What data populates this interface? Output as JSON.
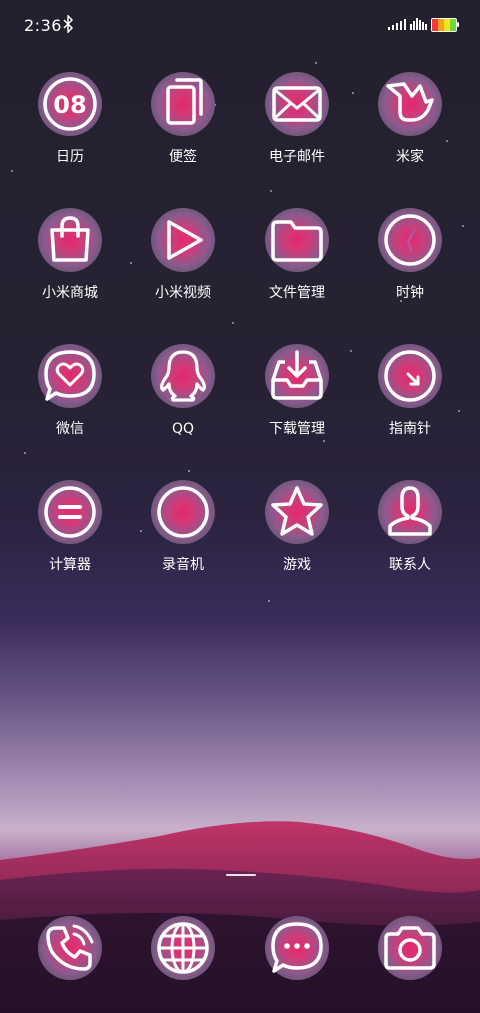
{
  "status_bar": {
    "time": "2:36",
    "bluetooth_icon": "bluetooth-icon",
    "signal_icon": "signal-icon",
    "battery_icon": "battery-icon"
  },
  "apps": [
    {
      "label": "日历",
      "icon": "calendar-icon",
      "icon_text": "08"
    },
    {
      "label": "便签",
      "icon": "notes-icon"
    },
    {
      "label": "电子邮件",
      "icon": "mail-icon"
    },
    {
      "label": "米家",
      "icon": "mijia-icon"
    },
    {
      "label": "小米商城",
      "icon": "shopping-bag-icon"
    },
    {
      "label": "小米视频",
      "icon": "play-icon"
    },
    {
      "label": "文件管理",
      "icon": "folder-icon"
    },
    {
      "label": "时钟",
      "icon": "clock-icon"
    },
    {
      "label": "微信",
      "icon": "chat-heart-icon"
    },
    {
      "label": "QQ",
      "icon": "penguin-icon"
    },
    {
      "label": "下载管理",
      "icon": "download-icon"
    },
    {
      "label": "指南针",
      "icon": "compass-icon"
    },
    {
      "label": "计算器",
      "icon": "calculator-icon"
    },
    {
      "label": "录音机",
      "icon": "recorder-icon"
    },
    {
      "label": "游戏",
      "icon": "star-icon"
    },
    {
      "label": "联系人",
      "icon": "contact-icon"
    }
  ],
  "dock": [
    {
      "icon": "phone-icon"
    },
    {
      "icon": "globe-icon"
    },
    {
      "icon": "message-icon"
    },
    {
      "icon": "camera-icon"
    }
  ],
  "colors": {
    "accent": "#e4286c",
    "icon_stroke": "#ffffff",
    "background_top": "#23202f"
  }
}
